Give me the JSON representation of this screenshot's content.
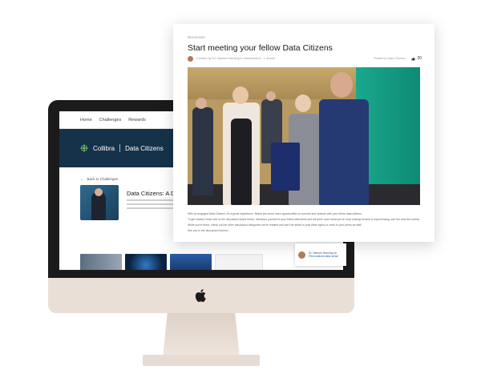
{
  "imac": {
    "nav": [
      "Home",
      "Challenges",
      "Rewards"
    ],
    "hero": {
      "brand": "Collibra",
      "community": "Data Citizens"
    },
    "back_link": "Back to Challenges",
    "challenge_title": "Data Citizens: A Di",
    "apple_logo_icon": "apple-logo-icon"
  },
  "post": {
    "category": "Discussion",
    "title": "Start meeting your fellow Data Citizens",
    "meta": "Created by DJ Samuel Harming in Introductions - 1 minute",
    "meta_right": "Posted in Data Citizens",
    "likes": "20",
    "body": [
      "With an engaged Data Citizens, it's a great experience. Below are some more opportunities to connect and network with your fellow data citizens.",
      "To get started, head over to the discussion board below. Introduce yourself to your fellow attendees and tell them more what you're most looking forward to experiencing over the next few weeks.",
      "While you're there, check out the other discussion categories we've created and don't be afraid to post other topics or react to your peers as well!",
      "See you in the discussion forums!"
    ]
  },
  "notification": {
    "text": "Dr. Samuel Harming on Personalized data sense"
  },
  "colors": {
    "hero_bg": "#16324a",
    "brand_green": "#7cc36b",
    "imac_chin": "#eadfd6"
  }
}
